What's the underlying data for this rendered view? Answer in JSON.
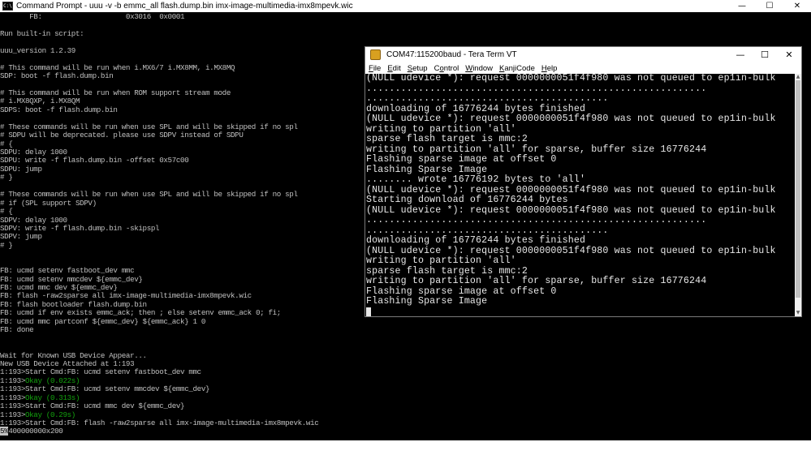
{
  "cmd": {
    "title": "Command Prompt - uuu  -v -b emmc_all flash.dump.bin  imx-image-multimedia-imx8mpevk.wic",
    "icon": "C:\\",
    "controls": {
      "minimize": "—",
      "maximize": "☐",
      "close": "✕"
    },
    "lines": [
      "       FB:                    0x3016  0x0001",
      "",
      "Run built-in script:",
      "",
      "uuu_version 1.2.39",
      "",
      "# This command will be run when i.MX6/7 i.MX8MM, i.MX8MQ",
      "SDP: boot -f flash.dump.bin",
      "",
      "# This command will be run when ROM support stream mode",
      "# i.MX8QXP, i.MX8QM",
      "SDPS: boot -f flash.dump.bin",
      "",
      "# These commands will be run when use SPL and will be skipped if no spl",
      "# SDPU will be deprecated. please use SDPV instead of SDPU",
      "# {",
      "SDPU: delay 1000",
      "SDPU: write -f flash.dump.bin -offset 0x57c00",
      "SDPU: jump",
      "# }",
      "",
      "# These commands will be run when use SPL and will be skipped if no spl",
      "# if (SPL support SDPV)",
      "# {",
      "SDPV: delay 1000",
      "SDPV: write -f flash.dump.bin -skipspl",
      "SDPV: jump",
      "# }",
      "",
      "",
      "FB: ucmd setenv fastboot_dev mmc",
      "FB: ucmd setenv mmcdev ${emmc_dev}",
      "FB: ucmd mmc dev ${emmc_dev}",
      "FB: flash -raw2sparse all imx-image-multimedia-imx8mpevk.wic",
      "FB: flash bootloader flash.dump.bin",
      "FB: ucmd if env exists emmc_ack; then ; else setenv emmc_ack 0; fi;",
      "FB: ucmd mmc partconf ${emmc_dev} ${emmc_ack} 1 0",
      "FB: done",
      "",
      "",
      "Wait for Known USB Device Appear...",
      "New USB Device Attached at 1:193",
      "1:193>Start Cmd:FB: ucmd setenv fastboot_dev mmc"
    ],
    "okay_lines": [
      {
        "prefix": "1:193>",
        "status": "Okay (0.022s)"
      },
      {
        "cmd": "1:193>Start Cmd:FB: ucmd setenv mmcdev ${emmc_dev}"
      },
      {
        "prefix": "1:193>",
        "status": "Okay (0.313s)"
      },
      {
        "cmd": "1:193>Start Cmd:FB: ucmd mmc dev ${emmc_dev}"
      },
      {
        "prefix": "1:193>",
        "status": "Okay (0.29s)"
      },
      {
        "cmd": "1:193>Start Cmd:FB: flash -raw2sparse all imx-image-multimedia-imx8mpevk.wic"
      }
    ],
    "progress_line": {
      "highlight": "5%",
      "rest": "400000000x200"
    }
  },
  "teraterm": {
    "title": "COM47:115200baud - Tera Term VT",
    "controls": {
      "minimize": "—",
      "maximize": "☐",
      "close": "✕"
    },
    "menu": [
      "File",
      "Edit",
      "Setup",
      "Control",
      "Window",
      "KanjiCode",
      "Help"
    ],
    "menu_underline": [
      "F",
      "E",
      "S",
      "o",
      "W",
      "K",
      "H"
    ],
    "lines": [
      "(NULL udevice *): request 0000000051f4f980 was not queued to ep1in-bulk",
      "...........................................................",
      "..........................................",
      "downloading of 16776244 bytes finished",
      "(NULL udevice *): request 0000000051f4f980 was not queued to ep1in-bulk",
      "writing to partition 'all'",
      "sparse flash target is mmc:2",
      "writing to partition 'all' for sparse, buffer size 16776244",
      "Flashing sparse image at offset 0",
      "Flashing Sparse Image",
      "........ wrote 16776192 bytes to 'all'",
      "(NULL udevice *): request 0000000051f4f980 was not queued to ep1in-bulk",
      "Starting download of 16776244 bytes",
      "(NULL udevice *): request 0000000051f4f980 was not queued to ep1in-bulk",
      "...........................................................",
      "..........................................",
      "downloading of 16776244 bytes finished",
      "(NULL udevice *): request 0000000051f4f980 was not queued to ep1in-bulk",
      "writing to partition 'all'",
      "sparse flash target is mmc:2",
      "writing to partition 'all' for sparse, buffer size 16776244",
      "Flashing sparse image at offset 0",
      "Flashing Sparse Image"
    ]
  },
  "colors": {
    "console_text": "#c0c0c0",
    "okay_green": "#13a10e",
    "tera_text": "#e8e8e8"
  }
}
